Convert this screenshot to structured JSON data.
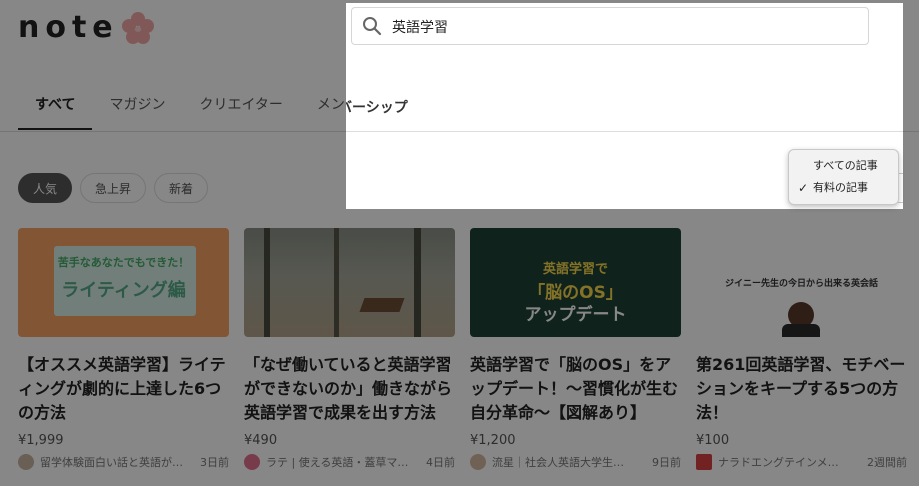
{
  "logo": {
    "text": "note"
  },
  "search": {
    "query": "英語学習"
  },
  "tabs": [
    {
      "label": "すべて",
      "active": true
    },
    {
      "label": "マガジン"
    },
    {
      "label": "クリエイター"
    },
    {
      "label": "メンバーシップ"
    }
  ],
  "filters": [
    {
      "label": "人気",
      "active": true
    },
    {
      "label": "急上昇"
    },
    {
      "label": "新着"
    }
  ],
  "cards": [
    {
      "title": "【オススメ英語学習】ライティングが劇的に上達した6つの方法",
      "price": "¥1,999",
      "author": "留学体験面白い話と英語が…",
      "time": "3日前",
      "thumb_line1": "苦手なあなたでもできた！",
      "thumb_line2": "ライティング編"
    },
    {
      "title": "「なぜ働いていると英語学習ができないのか」働きながら英語学習で成果を出す方法",
      "price": "¥490",
      "author": "ラテ | 使える英語・蓋草マ…",
      "time": "4日前"
    },
    {
      "title": "英語学習で「脳のOS」をアップデート！〜習慣化が生む自分革命〜【図解あり】",
      "price": "¥1,200",
      "author": "流星｜社会人英語大学生…",
      "time": "9日前",
      "thumb_line1": "英語学習で",
      "thumb_line2": "「脳のOS」",
      "thumb_line3": "アップデート"
    },
    {
      "title": "第261回英語学習、モチベーションをキープする5つの方法！",
      "price": "¥100",
      "author": "ナラドエングテインメ…",
      "time": "2週間前",
      "thumb_line1": "ジイニー先生の今日から出来る英会話"
    }
  ],
  "panel": {
    "tab_label": "メンバーシップ"
  },
  "dropdown": {
    "options": [
      {
        "label": "すべての記事",
        "selected": false
      },
      {
        "label": "有料の記事",
        "selected": true
      }
    ],
    "check": "✓"
  },
  "colors": {
    "overlay": "#000000",
    "logo_flower": "#f4a6a6",
    "card1_bg": "#f5a062",
    "card1_inner": "#d8efe6",
    "card3_bg": "#1e4035",
    "card3_accent": "#f7d84a"
  }
}
